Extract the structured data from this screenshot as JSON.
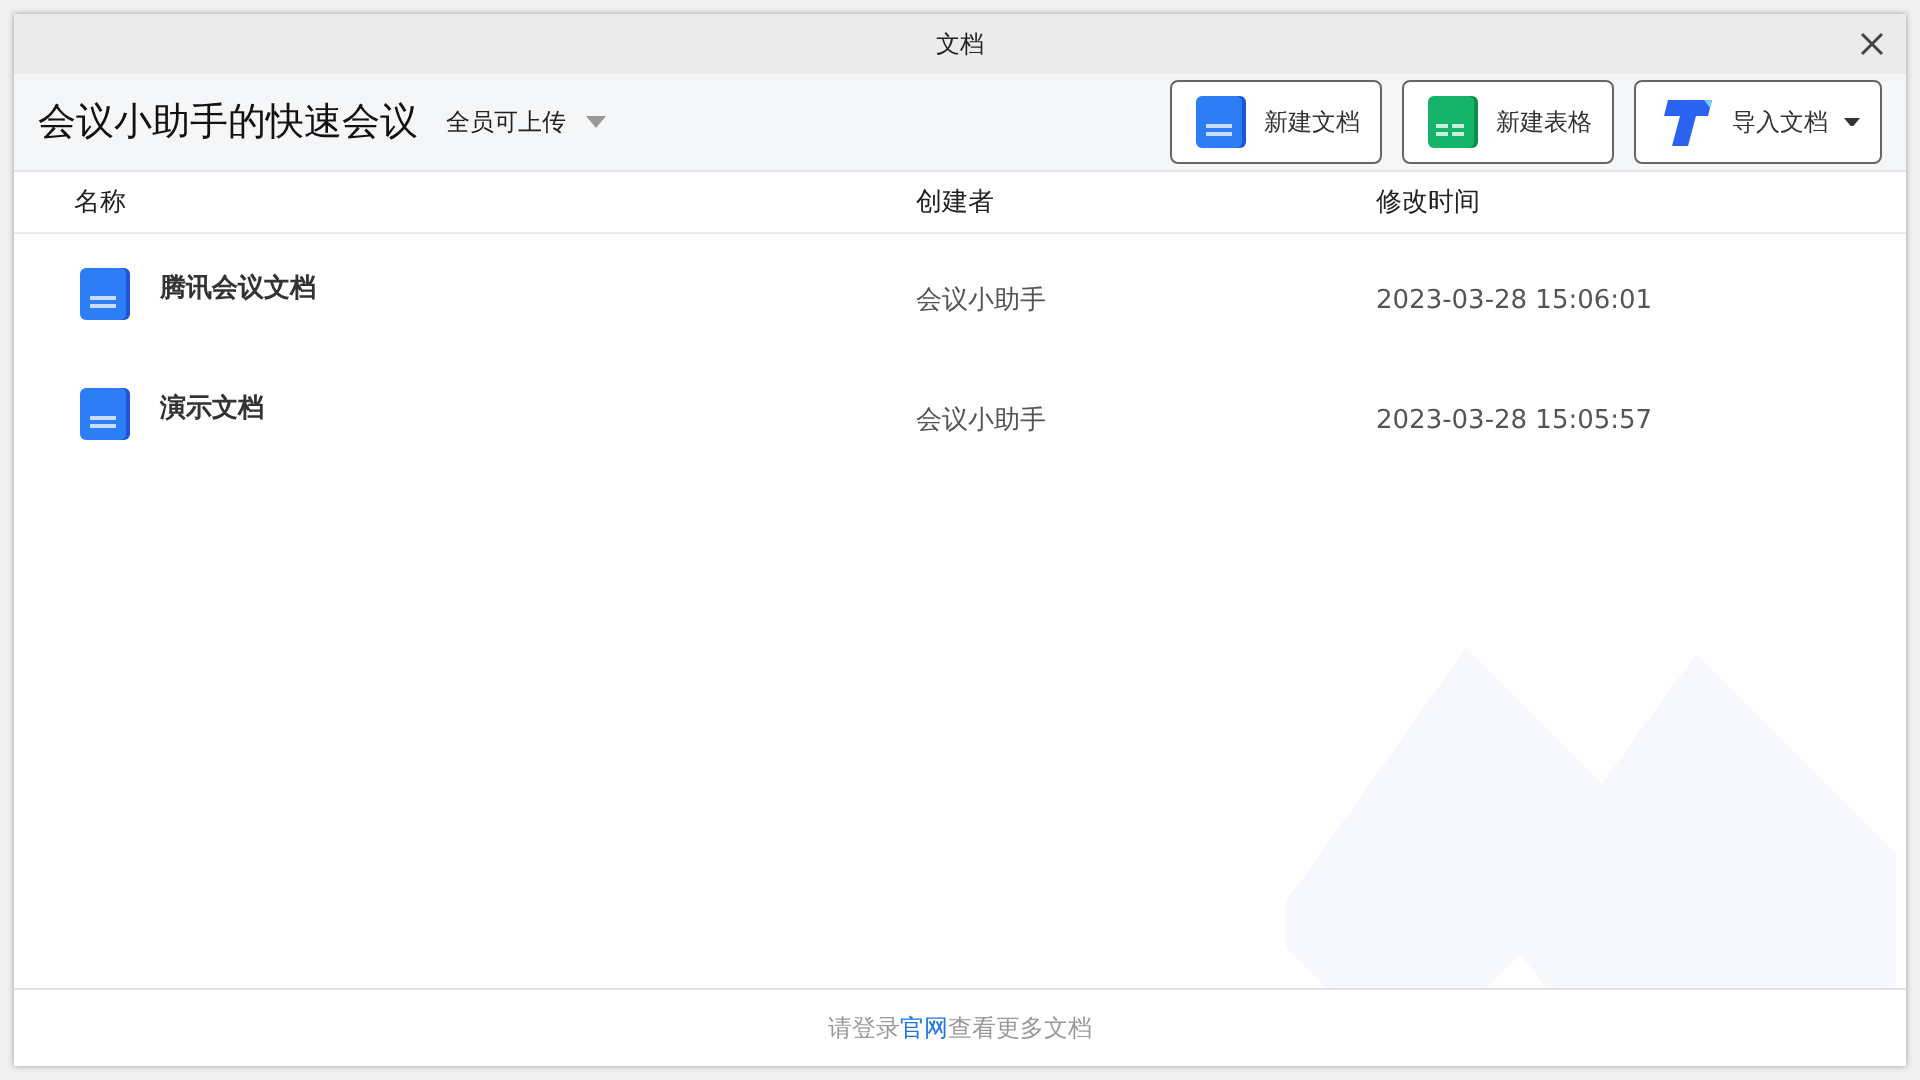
{
  "window": {
    "title": "文档"
  },
  "header": {
    "title": "会议小助手的快速会议",
    "permission": "全员可上传"
  },
  "actions": [
    {
      "kind": "doc",
      "label": "新建文档"
    },
    {
      "kind": "sheet",
      "label": "新建表格"
    },
    {
      "kind": "import",
      "label": "导入文档",
      "dropdown": true
    }
  ],
  "table": {
    "columns": [
      "名称",
      "创建者",
      "修改时间"
    ],
    "rows": [
      {
        "name": "腾讯会议文档",
        "creator": "会议小助手",
        "modified": "2023-03-28 15:06:01"
      },
      {
        "name": "演示文档",
        "creator": "会议小助手",
        "modified": "2023-03-28 15:05:57"
      }
    ]
  },
  "footer": {
    "before": "请登录",
    "link": "官网",
    "after": "查看更多文档"
  }
}
